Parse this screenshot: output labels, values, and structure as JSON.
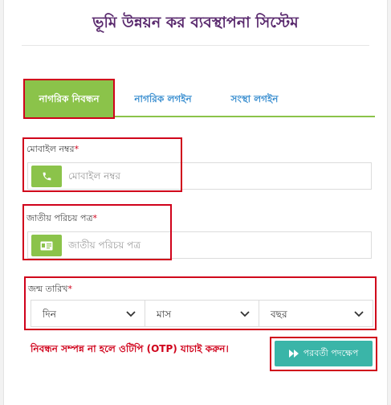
{
  "app": {
    "title": "ভূমি উন্নয়ন কর ব্যবস্থাপনা সিস্টেম"
  },
  "tabs": [
    {
      "label": "নাগরিক নিবন্ধন",
      "active": true
    },
    {
      "label": "নাগরিক লগইন",
      "active": false
    },
    {
      "label": "সংস্থা লগইন",
      "active": false
    }
  ],
  "form": {
    "mobile": {
      "label": "মোবাইল নম্বর",
      "required_mark": "*",
      "placeholder": "মোবাইল নম্বর",
      "icon": "phone-icon"
    },
    "nid": {
      "label": "জাতীয় পরিচয় পত্র",
      "required_mark": "*",
      "placeholder": "জাতীয় পরিচয় পত্র",
      "icon": "id-card-icon"
    },
    "dob": {
      "label": "জন্ম তারিখ",
      "required_mark": "*",
      "day": "দিন",
      "month": "মাস",
      "year": "বছর"
    }
  },
  "warning": "নিবন্ধন সম্পন্ন না হলে ওটিপি (OTP) যাচাই করুন।",
  "next_button": {
    "label": "পরবর্তী পদক্ষেপ",
    "icon": "fast-forward-icon"
  },
  "colors": {
    "accent_green": "#8bc34a",
    "teal": "#3ab5a8",
    "title_purple": "#5a2a6e",
    "tab_blue": "#3b8fd0",
    "highlight_red": "#d0021b"
  }
}
